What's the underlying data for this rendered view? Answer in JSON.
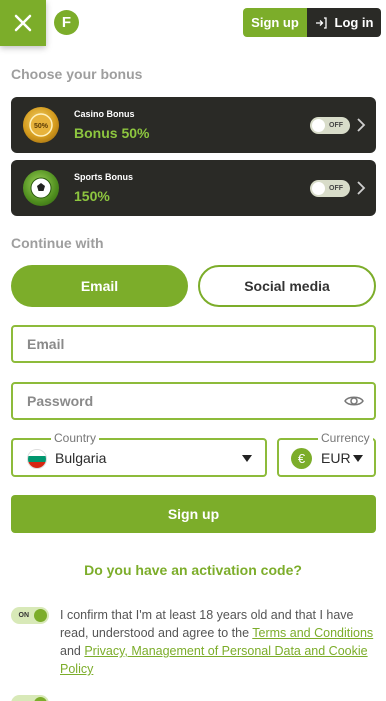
{
  "header": {
    "signup_label": "Sign up",
    "login_label": "Log in",
    "logo_letter": "F"
  },
  "bonus": {
    "title": "Choose your bonus",
    "items": [
      {
        "name": "Casino Bonus",
        "value": "Bonus 50%",
        "toggle": "OFF"
      },
      {
        "name": "Sports Bonus",
        "value": "150%",
        "toggle": "OFF"
      }
    ]
  },
  "continue": {
    "title": "Continue with",
    "tabs": [
      {
        "label": "Email",
        "active": true
      },
      {
        "label": "Social media",
        "active": false
      }
    ]
  },
  "form": {
    "email_placeholder": "Email",
    "password_placeholder": "Password",
    "country_label": "Country",
    "country_value": "Bulgaria",
    "currency_label": "Currency",
    "currency_value": "EUR",
    "currency_symbol": "€",
    "signup_label": "Sign up",
    "activation_link": "Do you have an activation code?"
  },
  "consent": {
    "toggle": "ON",
    "text_1": "I confirm that I'm at least 18 years old and that I have read, understood and agree to the ",
    "link_terms": "Terms and Conditions ",
    "text_2": "and ",
    "link_privacy": "Privacy, Management of Personal Data and Cookie Policy",
    "text_3": ""
  },
  "colors": {
    "accent": "#7cad2a",
    "dark": "#2a2a26",
    "bonus_value": "#8dc63f"
  }
}
